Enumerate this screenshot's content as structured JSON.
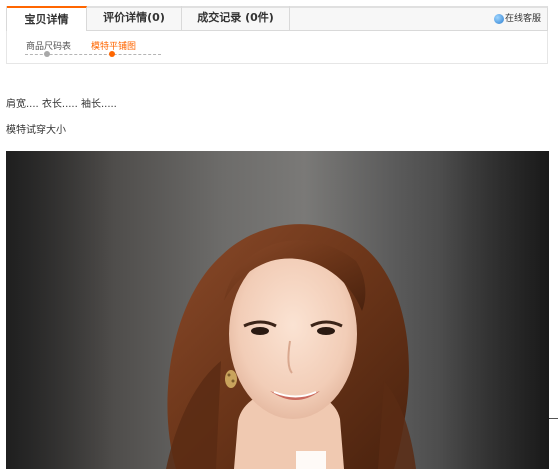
{
  "tabs": {
    "active_label": "宝贝详情",
    "reviews_label": "评价详情",
    "reviews_count": "(0)",
    "records_label": "成交记录",
    "records_count": "(0件)"
  },
  "online_service": {
    "label": "在线客服",
    "icon": "customer-service-icon"
  },
  "subnav": {
    "items": [
      {
        "label": "商品尺码表"
      },
      {
        "label": "模特平铺图"
      }
    ],
    "active_color": "#ff6600"
  },
  "content": {
    "measurements": "肩宽....   衣长.....   袖长.....",
    "fitting_note": "模特试穿大小"
  },
  "colors": {
    "accent": "#ff6600"
  }
}
